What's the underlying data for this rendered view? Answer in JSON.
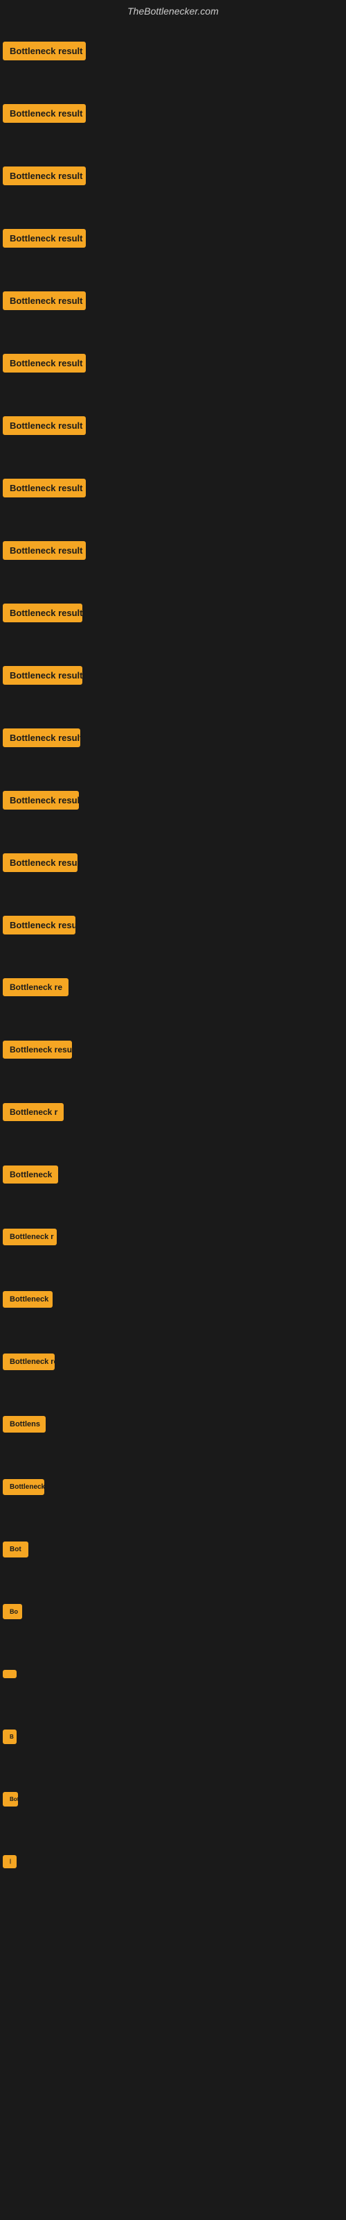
{
  "site": {
    "title": "TheBottlenecker.com"
  },
  "items": [
    {
      "id": 1,
      "label": "Bottleneck result",
      "size_class": "size-1",
      "width": 120
    },
    {
      "id": 2,
      "label": "Bottleneck result",
      "size_class": "size-1",
      "width": 120
    },
    {
      "id": 3,
      "label": "Bottleneck result",
      "size_class": "size-1",
      "width": 120
    },
    {
      "id": 4,
      "label": "Bottleneck result",
      "size_class": "size-1",
      "width": 120
    },
    {
      "id": 5,
      "label": "Bottleneck result",
      "size_class": "size-1",
      "width": 120
    },
    {
      "id": 6,
      "label": "Bottleneck result",
      "size_class": "size-1",
      "width": 120
    },
    {
      "id": 7,
      "label": "Bottleneck result",
      "size_class": "size-1",
      "width": 120
    },
    {
      "id": 8,
      "label": "Bottleneck result",
      "size_class": "size-1",
      "width": 120
    },
    {
      "id": 9,
      "label": "Bottleneck result",
      "size_class": "size-1",
      "width": 120
    },
    {
      "id": 10,
      "label": "Bottleneck result",
      "size_class": "size-1",
      "width": 115
    },
    {
      "id": 11,
      "label": "Bottleneck result",
      "size_class": "size-1",
      "width": 115
    },
    {
      "id": 12,
      "label": "Bottleneck result",
      "size_class": "size-1",
      "width": 112
    },
    {
      "id": 13,
      "label": "Bottleneck result",
      "size_class": "size-1",
      "width": 110
    },
    {
      "id": 14,
      "label": "Bottleneck result",
      "size_class": "size-1",
      "width": 108
    },
    {
      "id": 15,
      "label": "Bottleneck result",
      "size_class": "size-1",
      "width": 105
    },
    {
      "id": 16,
      "label": "Bottleneck re",
      "size_class": "size-2",
      "width": 95
    },
    {
      "id": 17,
      "label": "Bottleneck result",
      "size_class": "size-2",
      "width": 100
    },
    {
      "id": 18,
      "label": "Bottleneck r",
      "size_class": "size-2",
      "width": 88
    },
    {
      "id": 19,
      "label": "Bottleneck",
      "size_class": "size-2",
      "width": 80
    },
    {
      "id": 20,
      "label": "Bottleneck r",
      "size_class": "size-3",
      "width": 78
    },
    {
      "id": 21,
      "label": "Bottleneck",
      "size_class": "size-3",
      "width": 72
    },
    {
      "id": 22,
      "label": "Bottleneck res",
      "size_class": "size-3",
      "width": 75
    },
    {
      "id": 23,
      "label": "Bottlens",
      "size_class": "size-3",
      "width": 62
    },
    {
      "id": 24,
      "label": "Bottleneck",
      "size_class": "size-4",
      "width": 60
    },
    {
      "id": 25,
      "label": "Bot",
      "size_class": "size-4",
      "width": 38
    },
    {
      "id": 26,
      "label": "Bo",
      "size_class": "size-5",
      "width": 28
    },
    {
      "id": 27,
      "label": "",
      "size_class": "size-5",
      "width": 18
    },
    {
      "id": 28,
      "label": "B",
      "size_class": "size-6",
      "width": 16
    },
    {
      "id": 29,
      "label": "Bott",
      "size_class": "size-6",
      "width": 22
    },
    {
      "id": 30,
      "label": "|",
      "size_class": "size-7",
      "width": 10
    }
  ]
}
